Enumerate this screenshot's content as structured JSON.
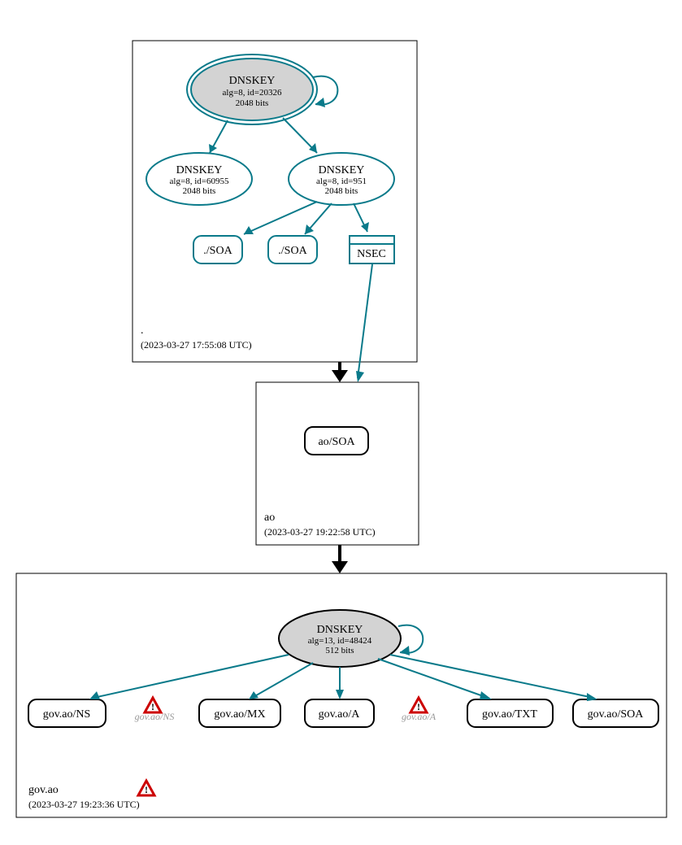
{
  "zones": {
    "root": {
      "name": ".",
      "timestamp": "(2023-03-27 17:55:08 UTC)",
      "ksk": {
        "title": "DNSKEY",
        "alg": "alg=8, id=20326",
        "bits": "2048 bits"
      },
      "zsk1": {
        "title": "DNSKEY",
        "alg": "alg=8, id=60955",
        "bits": "2048 bits"
      },
      "zsk2": {
        "title": "DNSKEY",
        "alg": "alg=8, id=951",
        "bits": "2048 bits"
      },
      "soa1": "./SOA",
      "soa2": "./SOA",
      "nsec": "NSEC"
    },
    "ao": {
      "name": "ao",
      "timestamp": "(2023-03-27 19:22:58 UTC)",
      "soa": "ao/SOA"
    },
    "govao": {
      "name": "gov.ao",
      "timestamp": "(2023-03-27 19:23:36 UTC)",
      "key": {
        "title": "DNSKEY",
        "alg": "alg=13, id=48424",
        "bits": "512 bits"
      },
      "ns": "gov.ao/NS",
      "ns_ghost": "gov.ao/NS",
      "mx": "gov.ao/MX",
      "a": "gov.ao/A",
      "a_ghost": "gov.ao/A",
      "txt": "gov.ao/TXT",
      "soa": "gov.ao/SOA"
    }
  }
}
